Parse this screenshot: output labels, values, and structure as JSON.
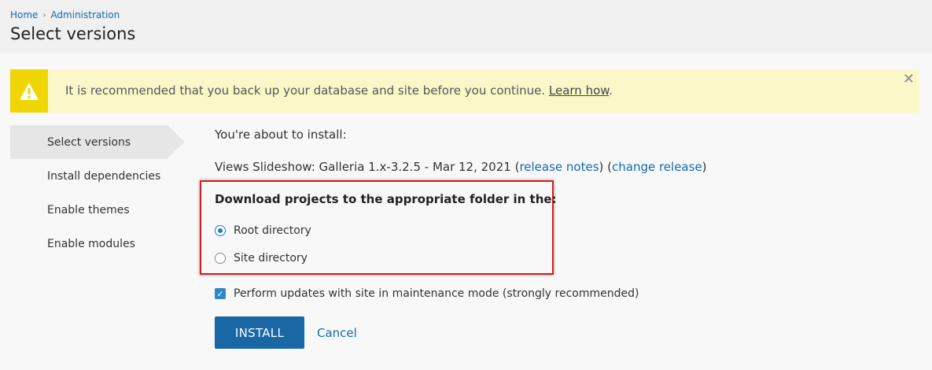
{
  "breadcrumb": {
    "home": "Home",
    "admin": "Administration"
  },
  "page_title": "Select versions",
  "warning": {
    "message": "It is recommended that you back up your database and site before you continue.",
    "link": "Learn how",
    "end": "."
  },
  "sidebar": {
    "items": [
      {
        "label": "Select versions",
        "active": true
      },
      {
        "label": "Install dependencies"
      },
      {
        "label": "Enable themes"
      },
      {
        "label": "Enable modules"
      }
    ]
  },
  "main": {
    "about": "You're about to install:",
    "project": "Views Slideshow: Galleria 1.x-3.2.5 - Mar 12, 2021",
    "release_notes": "release notes",
    "change_release": "change release",
    "download_title": "Download projects to the appropriate folder in the:",
    "radio_root": "Root directory",
    "radio_site": "Site directory",
    "maintenance": "Perform updates with site in maintenance mode (strongly recommended)",
    "install": "INSTALL",
    "cancel": "Cancel"
  },
  "colors": {
    "accent": "#1a67a6",
    "warning": "#efd600",
    "highlight": "#d31c1c"
  }
}
